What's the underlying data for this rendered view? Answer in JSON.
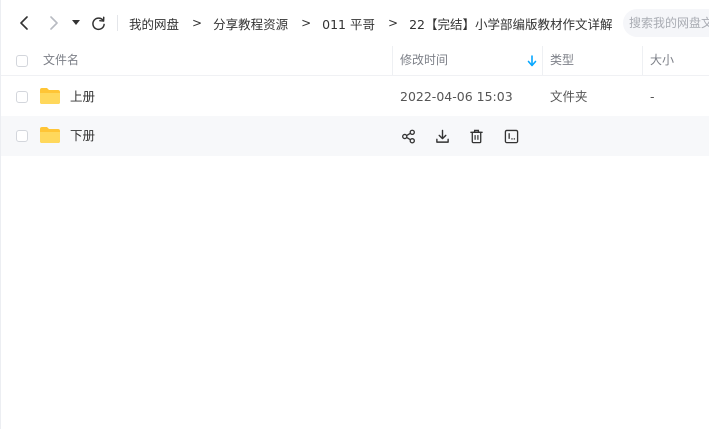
{
  "toolbar": {
    "back_icon": "chevron-left-icon",
    "forward_icon": "chevron-right-icon",
    "history_icon": "caret-down-icon",
    "refresh_icon": "refresh-icon"
  },
  "breadcrumb": {
    "items": [
      "我的网盘",
      "分享教程资源",
      "011 平哥",
      "22【完结】小学部编版教材作文详解"
    ],
    "separator": ">"
  },
  "search": {
    "placeholder": "搜索我的网盘文件"
  },
  "columns": {
    "name": "文件名",
    "mtime": "修改时间",
    "type": "类型",
    "size": "大小",
    "sort_icon": "sort-down-arrow-icon"
  },
  "files": [
    {
      "name": "上册",
      "mtime": "2022-04-06 15:03",
      "type": "文件夹",
      "size": "-",
      "icon": "folder-icon"
    },
    {
      "name": "下册",
      "mtime": "",
      "type": "",
      "size": "",
      "icon": "folder-icon",
      "actions": [
        "share-icon",
        "download-icon",
        "delete-icon",
        "more-icon"
      ]
    }
  ],
  "colors": {
    "folder": "#FFCF3F",
    "accent": "#06a7ff",
    "hover_row": "#f7f8fa"
  }
}
